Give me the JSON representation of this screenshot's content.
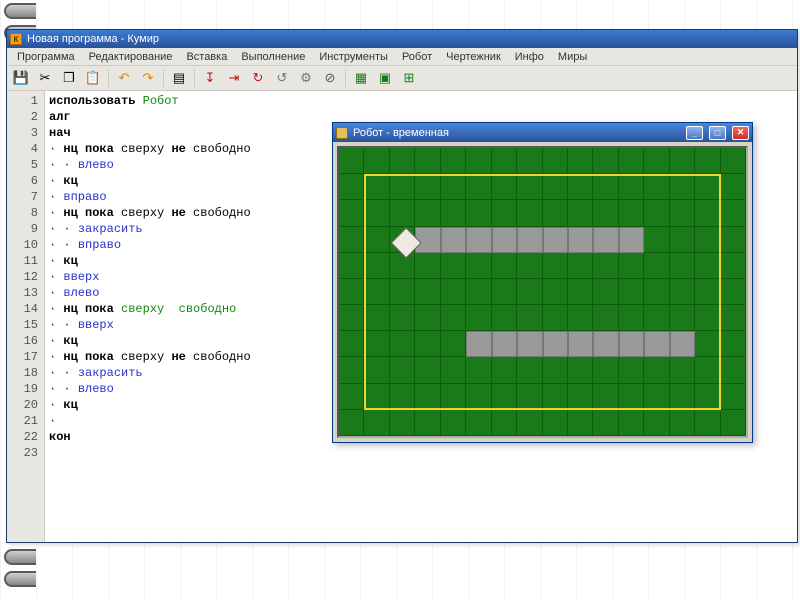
{
  "app": {
    "title": "Новая программа - Кумир",
    "icon_letter": "К"
  },
  "menu": [
    "Программа",
    "Редактирование",
    "Вставка",
    "Выполнение",
    "Инструменты",
    "Робот",
    "Чертежник",
    "Инфо",
    "Миры"
  ],
  "toolbar": [
    {
      "name": "save-icon",
      "glyph": "💾"
    },
    {
      "name": "cut-icon",
      "glyph": "✂"
    },
    {
      "name": "copy-icon",
      "glyph": "❐"
    },
    {
      "name": "paste-icon",
      "glyph": "📋"
    },
    {
      "sep": true
    },
    {
      "name": "undo-icon",
      "glyph": "↶",
      "color": "#d88a00"
    },
    {
      "name": "redo-icon",
      "glyph": "↷",
      "color": "#d88a00"
    },
    {
      "sep": true
    },
    {
      "name": "list-icon",
      "glyph": "▤"
    },
    {
      "sep": true
    },
    {
      "name": "run-step-icon",
      "glyph": "↧",
      "color": "#c01515"
    },
    {
      "name": "run-icon",
      "glyph": "⇥",
      "color": "#c01515"
    },
    {
      "name": "loop-icon",
      "glyph": "↻",
      "color": "#c01515"
    },
    {
      "name": "skip-icon",
      "glyph": "↺",
      "color": "#777"
    },
    {
      "name": "cog-icon",
      "glyph": "⚙",
      "color": "#777"
    },
    {
      "name": "stop-icon",
      "glyph": "⊘",
      "color": "#555"
    },
    {
      "sep": true
    },
    {
      "name": "grid-green-icon",
      "glyph": "▦",
      "color": "#1a7a1a"
    },
    {
      "name": "grid-outline-icon",
      "glyph": "▣",
      "color": "#1a7a1a"
    },
    {
      "name": "grid-plus-icon",
      "glyph": "⊞",
      "color": "#1a7a1a"
    }
  ],
  "code_lines": [
    [
      [
        "kw",
        "использовать"
      ],
      [
        "",
        " "
      ],
      [
        "green",
        "Робот"
      ]
    ],
    [
      [
        "kw",
        "алг"
      ]
    ],
    [
      [
        "kw",
        "нач"
      ]
    ],
    [
      [
        "dot",
        "· "
      ],
      [
        "kw",
        "нц"
      ],
      [
        "",
        " "
      ],
      [
        "kw",
        "пока"
      ],
      [
        "",
        " сверху "
      ],
      [
        "kw",
        "не"
      ],
      [
        "",
        " свободно"
      ]
    ],
    [
      [
        "dot",
        "· · "
      ],
      [
        "blue",
        "влево"
      ]
    ],
    [
      [
        "dot",
        "· "
      ],
      [
        "kw",
        "кц"
      ]
    ],
    [
      [
        "dot",
        "· "
      ],
      [
        "blue",
        "вправо"
      ]
    ],
    [
      [
        "dot",
        "· "
      ],
      [
        "kw",
        "нц"
      ],
      [
        "",
        " "
      ],
      [
        "kw",
        "пока"
      ],
      [
        "",
        " сверху "
      ],
      [
        "kw",
        "не"
      ],
      [
        "",
        " свободно"
      ]
    ],
    [
      [
        "dot",
        "· · "
      ],
      [
        "blue",
        "закрасить"
      ]
    ],
    [
      [
        "dot",
        "· · "
      ],
      [
        "blue",
        "вправо"
      ]
    ],
    [
      [
        "dot",
        "· "
      ],
      [
        "kw",
        "кц"
      ]
    ],
    [
      [
        "dot",
        "· "
      ],
      [
        "blue",
        "вверх"
      ]
    ],
    [
      [
        "dot",
        "· "
      ],
      [
        "blue",
        "влево"
      ]
    ],
    [
      [
        "dot",
        "· "
      ],
      [
        "kw",
        "нц"
      ],
      [
        "",
        " "
      ],
      [
        "kw",
        "пока"
      ],
      [
        "",
        " "
      ],
      [
        "green",
        "сверху  свободно"
      ]
    ],
    [
      [
        "dot",
        "· · "
      ],
      [
        "blue",
        "вверх"
      ]
    ],
    [
      [
        "dot",
        "· "
      ],
      [
        "kw",
        "кц"
      ]
    ],
    [
      [
        "dot",
        "· "
      ],
      [
        "kw",
        "нц"
      ],
      [
        "",
        " "
      ],
      [
        "kw",
        "пока"
      ],
      [
        "",
        " сверху "
      ],
      [
        "kw",
        "не"
      ],
      [
        "",
        " свободно"
      ]
    ],
    [
      [
        "dot",
        "· · "
      ],
      [
        "blue",
        "закрасить"
      ]
    ],
    [
      [
        "dot",
        "· · "
      ],
      [
        "blue",
        "влево"
      ]
    ],
    [
      [
        "dot",
        "· "
      ],
      [
        "kw",
        "кц"
      ]
    ],
    [
      [
        "dot",
        "·"
      ]
    ],
    [
      [
        "kw",
        "кон"
      ]
    ],
    [
      [
        "",
        ""
      ]
    ]
  ],
  "line_count": 23,
  "robot_window": {
    "title": "Робот - временная",
    "cols": 16,
    "rows": 11,
    "walls": [
      {
        "row": 3,
        "col": 3,
        "len": 9
      },
      {
        "row": 7,
        "col": 5,
        "len": 9
      }
    ],
    "robot": {
      "row": 3,
      "col": 2
    }
  }
}
